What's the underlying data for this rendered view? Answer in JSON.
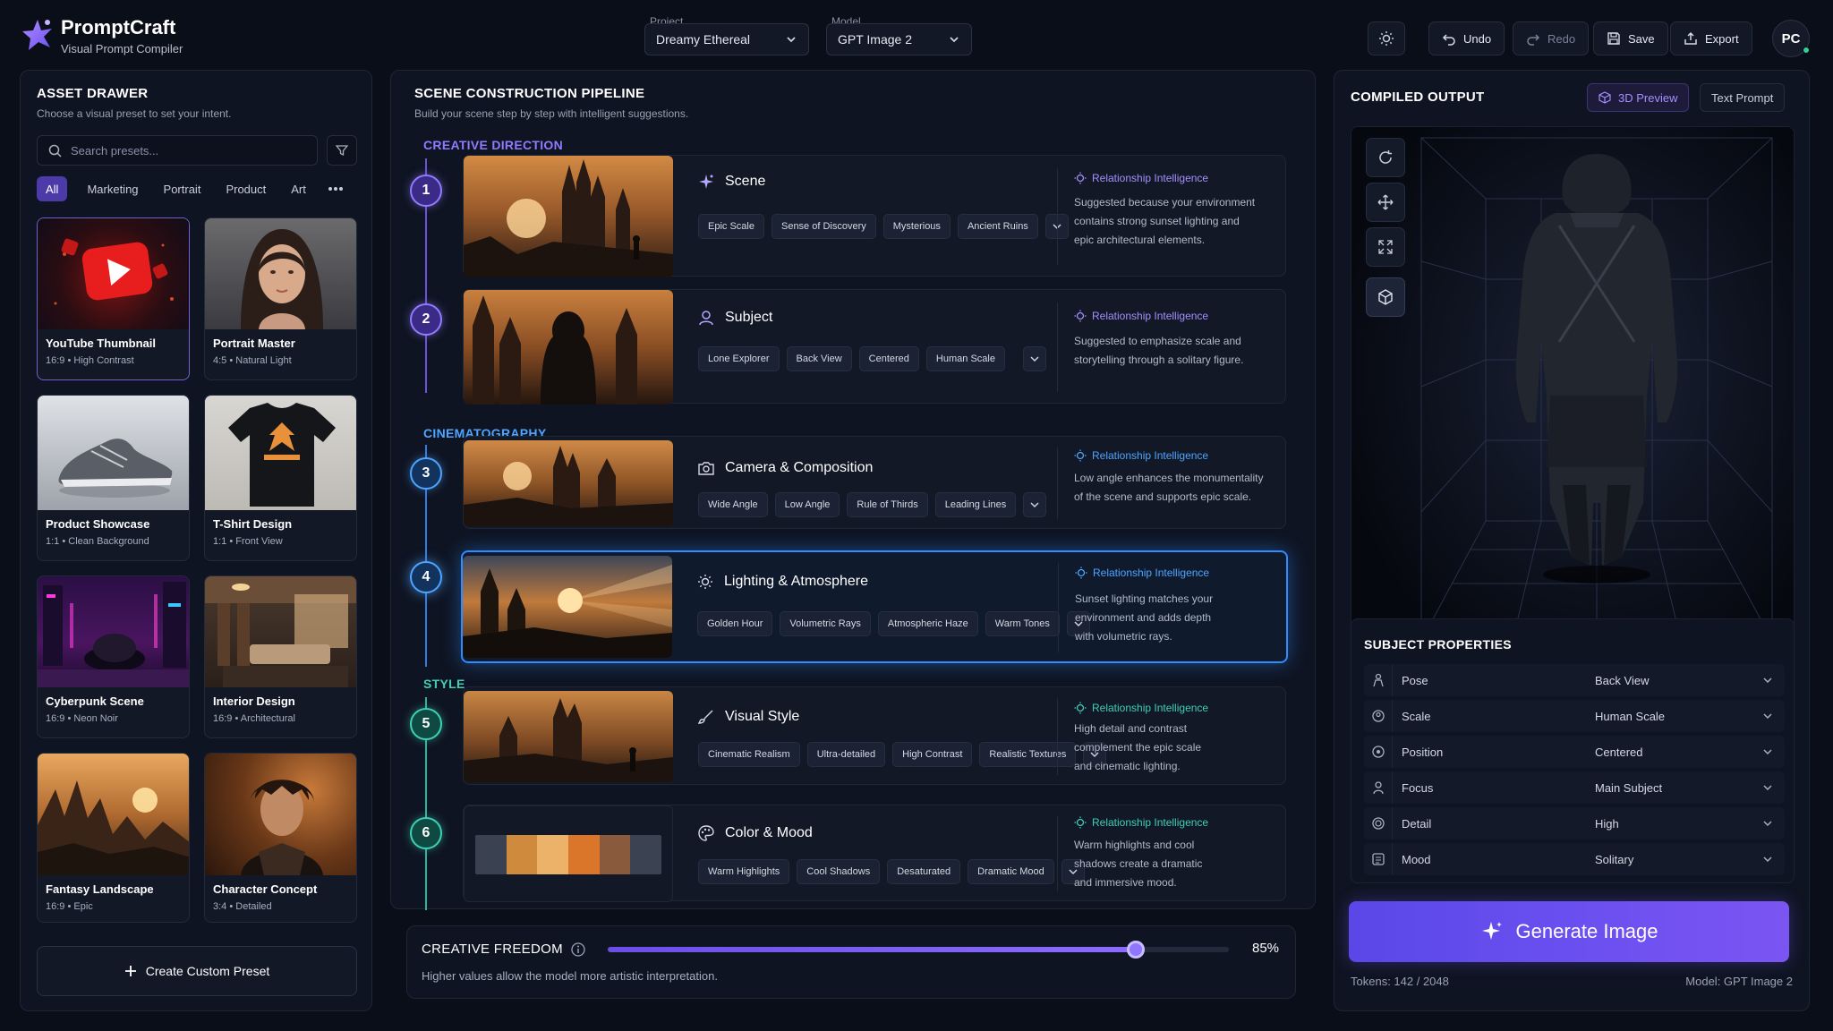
{
  "app": {
    "name": "PromptCraft",
    "tagline": "Visual Prompt Compiler"
  },
  "header": {
    "project_label": "Project",
    "project_value": "Dreamy Ethereal",
    "model_label": "Model",
    "model_value": "GPT Image 2",
    "undo": "Undo",
    "redo": "Redo",
    "save": "Save",
    "export": "Export",
    "avatar_initials": "PC"
  },
  "asset_drawer": {
    "title": "ASSET DRAWER",
    "subtitle": "Choose a visual preset to set your intent.",
    "search_placeholder": "Search presets...",
    "tabs": [
      "All",
      "Marketing",
      "Portrait",
      "Product",
      "Art"
    ],
    "presets": [
      {
        "name": "YouTube Thumbnail",
        "ratio": "16:9",
        "tag": "High Contrast",
        "selected": true
      },
      {
        "name": "Portrait Master",
        "ratio": "4:5",
        "tag": "Natural Light"
      },
      {
        "name": "Product Showcase",
        "ratio": "1:1",
        "tag": "Clean Background"
      },
      {
        "name": "T-Shirt Design",
        "ratio": "1:1",
        "tag": "Front View"
      },
      {
        "name": "Cyberpunk Scene",
        "ratio": "16:9",
        "tag": "Neon Noir"
      },
      {
        "name": "Interior Design",
        "ratio": "16:9",
        "tag": "Architectural"
      },
      {
        "name": "Fantasy Landscape",
        "ratio": "16:9",
        "tag": "Epic"
      },
      {
        "name": "Character Concept",
        "ratio": "3:4",
        "tag": "Detailed"
      }
    ],
    "create_button": "Create Custom Preset"
  },
  "pipeline": {
    "title": "SCENE CONSTRUCTION PIPELINE",
    "subtitle": "Build your scene step by step with intelligent suggestions.",
    "sections": {
      "creative": "CREATIVE DIRECTION",
      "cinematography": "CINEMATOGRAPHY",
      "style": "STYLE"
    },
    "ri_title": "Relationship Intelligence",
    "steps": [
      {
        "number": "1",
        "title": "Scene",
        "chips": [
          "Epic Scale",
          "Sense of Discovery",
          "Mysterious",
          "Ancient Ruins"
        ],
        "ri_lines": [
          "Suggested because your environment",
          "contains strong sunset lighting and",
          "epic architectural elements."
        ]
      },
      {
        "number": "2",
        "title": "Subject",
        "chips": [
          "Lone Explorer",
          "Back View",
          "Centered",
          "Human Scale"
        ],
        "ri_lines": [
          "Suggested to emphasize scale and",
          "storytelling through a solitary figure."
        ]
      },
      {
        "number": "3",
        "title": "Camera & Composition",
        "chips": [
          "Wide Angle",
          "Low Angle",
          "Rule of Thirds",
          "Leading Lines"
        ],
        "ri_lines": [
          "Low angle enhances the monumentality",
          "of the scene and supports epic scale."
        ]
      },
      {
        "number": "4",
        "title": "Lighting & Atmosphere",
        "chips": [
          "Golden Hour",
          "Volumetric Rays",
          "Atmospheric Haze",
          "Warm Tones"
        ],
        "ri_lines": [
          "Sunset lighting matches your",
          "environment and adds depth",
          "with volumetric rays."
        ]
      },
      {
        "number": "5",
        "title": "Visual Style",
        "chips": [
          "Cinematic Realism",
          "Ultra-detailed",
          "High Contrast",
          "Realistic Textures"
        ],
        "ri_lines": [
          "High detail and contrast",
          "complement the epic scale",
          "and cinematic lighting."
        ]
      },
      {
        "number": "6",
        "title": "Color & Mood",
        "chips": [
          "Warm Highlights",
          "Cool Shadows",
          "Desaturated",
          "Dramatic Mood"
        ],
        "ri_lines": [
          "Warm highlights and cool",
          "shadows create a dramatic",
          "and immersive mood."
        ]
      }
    ],
    "palette": [
      "#3a4150",
      "#d08a3e",
      "#edb26a",
      "#d9762a",
      "#8a5a3c",
      "#3b4352"
    ]
  },
  "creative_freedom": {
    "label": "CREATIVE FREEDOM",
    "value": "85%",
    "fraction": 0.85,
    "hint": "Higher values allow the model more artistic interpretation."
  },
  "compiled_output": {
    "title": "COMPILED OUTPUT",
    "tab_3d": "3D Preview",
    "tab_text": "Text Prompt"
  },
  "subject_properties": {
    "title": "SUBJECT PROPERTIES",
    "rows": [
      {
        "label": "Pose",
        "value": "Back View",
        "icon": "pose-icon"
      },
      {
        "label": "Scale",
        "value": "Human Scale",
        "icon": "scale-icon"
      },
      {
        "label": "Position",
        "value": "Centered",
        "icon": "position-icon"
      },
      {
        "label": "Focus",
        "value": "Main Subject",
        "icon": "focus-icon"
      },
      {
        "label": "Detail",
        "value": "High",
        "icon": "detail-icon"
      },
      {
        "label": "Mood",
        "value": "Solitary",
        "icon": "mood-icon"
      }
    ]
  },
  "generate": {
    "label": "Generate Image",
    "tokens": "Tokens: 142 / 2048",
    "model": "Model: GPT Image 2"
  },
  "colors": {
    "accent": "#6a4ff0",
    "creative": "#8f7bff",
    "cinematography": "#4ea4ff",
    "style": "#3ed0b6"
  }
}
